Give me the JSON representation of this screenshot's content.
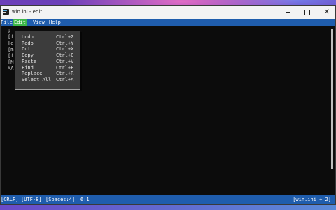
{
  "window": {
    "title": "win.ini - edit"
  },
  "window_controls": {
    "minimize": "—",
    "maximize": "□",
    "close": "✕"
  },
  "menubar": {
    "file": "File",
    "edit": "Edit",
    "view": "View",
    "help": "Help"
  },
  "editor": {
    "lines": [
      ";",
      "[f",
      "[e",
      "[m",
      "[f",
      "[M",
      "MA"
    ]
  },
  "edit_menu": {
    "items": [
      {
        "label": "Undo",
        "shortcut": "Ctrl+Z"
      },
      {
        "label": "Redo",
        "shortcut": "Ctrl+Y"
      },
      {
        "label": "Cut",
        "shortcut": "Ctrl+X"
      },
      {
        "label": "Copy",
        "shortcut": "Ctrl+C"
      },
      {
        "label": "Paste",
        "shortcut": "Ctrl+V"
      },
      {
        "label": "Find",
        "shortcut": "Ctrl+F"
      },
      {
        "label": "Replace",
        "shortcut": "Ctrl+R"
      },
      {
        "label": "Select All",
        "shortcut": "Ctrl+A"
      }
    ]
  },
  "statusbar": {
    "line_ending": "[CRLF]",
    "encoding": "[UTF-8]",
    "indent": "[Spaces:4]",
    "cursor": "6:1",
    "file": "[win.ini + 2]"
  },
  "colors": {
    "menubar": "#1f5dad",
    "edit_highlight": "#3db84a",
    "editor_bg": "#0c0c0c"
  }
}
